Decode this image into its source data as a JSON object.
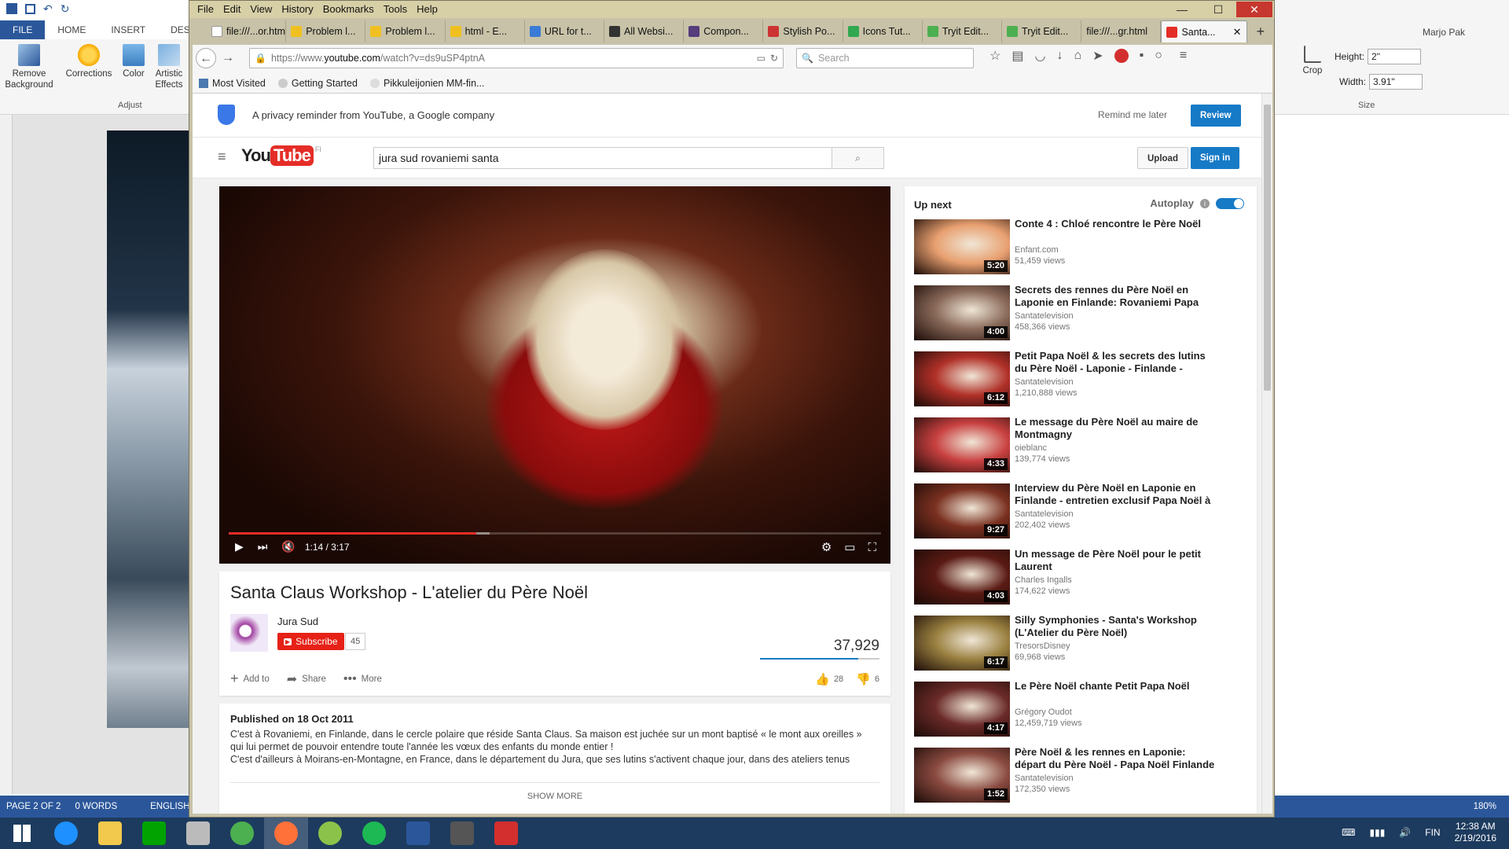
{
  "word": {
    "qat_title": "Marjo Pak",
    "tabs": [
      "FILE",
      "HOME",
      "INSERT",
      "DESIG"
    ],
    "ribbon_buttons": [
      {
        "label": "Remove Background"
      },
      {
        "label": "Corrections"
      },
      {
        "label": "Color"
      },
      {
        "label": "Artistic Effects"
      }
    ],
    "group_label": "Adjust",
    "right_group": {
      "crop_label": "Crop",
      "height_label": "Height:",
      "height_value": "2\"",
      "width_label": "Width:",
      "width_value": "3.91\"",
      "size_label": "Size"
    },
    "status": {
      "page": "PAGE 2 OF 2",
      "words": "0 WORDS",
      "language": "ENGLISH (",
      "zoom": "180%"
    }
  },
  "firefox": {
    "menu": [
      "File",
      "Edit",
      "View",
      "History",
      "Bookmarks",
      "Tools",
      "Help"
    ],
    "tabs": [
      {
        "label": "file:///...or.html",
        "color": "#ffffff"
      },
      {
        "label": "Problem l...",
        "color": "#f0c020"
      },
      {
        "label": "Problem l...",
        "color": "#f0c020"
      },
      {
        "label": "html - E...",
        "color": "#f0c020"
      },
      {
        "label": "URL for t...",
        "color": "#3a7bd5"
      },
      {
        "label": "All Websi...",
        "color": "#333333"
      },
      {
        "label": "Compon...",
        "color": "#563d7c"
      },
      {
        "label": "Stylish Po...",
        "color": "#cc3333"
      },
      {
        "label": "Icons Tut...",
        "color": "#2fa84f"
      },
      {
        "label": "Tryit Edit...",
        "color": "#4caf50"
      },
      {
        "label": "Tryit Edit...",
        "color": "#4caf50"
      },
      {
        "label": "file:///...gr.html",
        "color": "#ffffff"
      },
      {
        "label": "Santa...",
        "color": "#e52d27"
      }
    ],
    "url_prefix": "https://www.",
    "url_domain": "youtube.com",
    "url_path": "/watch?v=ds9uSP4ptnA",
    "search_placeholder": "Search",
    "bookmarks": [
      "Most Visited",
      "Getting Started",
      "Pikkuleijonien MM-fin..."
    ]
  },
  "youtube": {
    "privacy_text": "A privacy reminder from YouTube, a Google company",
    "remind_later": "Remind me later",
    "review": "Review",
    "logo_you": "You",
    "logo_tube": "Tube",
    "logo_region": "FI",
    "search_value": "jura sud rovaniemi santa",
    "upload": "Upload",
    "signin": "Sign in",
    "player": {
      "time": "1:14 / 3:17",
      "progress": 0.38,
      "buffered": 0.4
    },
    "video": {
      "title": "Santa Claus Workshop - L'atelier du Père Noël",
      "channel": "Jura Sud",
      "subscribe": "Subscribe",
      "subscribers": "45",
      "views": "37,929",
      "add_to": "Add to",
      "share": "Share",
      "more": "More",
      "likes": "28",
      "dislikes": "6"
    },
    "description": {
      "published": "Published on 18 Oct 2011",
      "line1": "C'est à Rovaniemi, en Finlande, dans le cercle polaire que réside Santa Claus. Sa maison est juchée sur un mont baptisé « le mont aux oreilles »",
      "line2": "qui lui permet de pouvoir entendre toute l'année les vœux des enfants du monde entier !",
      "line3": "C'est d'ailleurs à Moirans-en-Montagne, en France, dans le département du Jura, que ses lutins s'activent chaque jour, dans des ateliers tenus",
      "show_more": "SHOW MORE"
    },
    "up_next": "Up next",
    "autoplay": "Autoplay",
    "recommendations": [
      {
        "title": "Conte 4 : Chloé rencontre le Père Noël",
        "channel": "Enfant.com",
        "views": "51,459 views",
        "duration": "5:20",
        "color": "#e8a070"
      },
      {
        "title": "Secrets des rennes du Père Noël en Laponie en Finlande: Rovaniemi Papa Noël",
        "channel": "Santatelevision",
        "views": "458,366 views",
        "duration": "4:00",
        "color": "#8a6a5a"
      },
      {
        "title": "Petit Papa Noël & les secrets des lutins du Père Noël - Laponie - Finlande - Rovaniemi -",
        "channel": "Santatelevision",
        "views": "1,210,888 views",
        "duration": "6:12",
        "color": "#b03028"
      },
      {
        "title": "Le message du Père Noël au maire de Montmagny",
        "channel": "oieblanc",
        "views": "139,774 views",
        "duration": "4:33",
        "color": "#c84040"
      },
      {
        "title": "Interview du Père Noël en Laponie en Finlande - entretien exclusif Papa Noël à",
        "channel": "Santatelevision",
        "views": "202,402 views",
        "duration": "9:27",
        "color": "#7a3020"
      },
      {
        "title": "Un message de Père Noël pour le petit Laurent",
        "channel": "Charles Ingalls",
        "views": "174,622 views",
        "duration": "4:03",
        "color": "#5a1a14"
      },
      {
        "title": "Silly Symphonies - Santa's Workshop (L'Atelier du Père Noël)",
        "channel": "TresorsDisney",
        "views": "69,968 views",
        "duration": "6:17",
        "color": "#9a8040"
      },
      {
        "title": "Le Père Noël chante Petit Papa Noël",
        "channel": "Grégory Oudot",
        "views": "12,459,719 views",
        "duration": "4:17",
        "color": "#6a2a28"
      },
      {
        "title": "Père Noël & les rennes en Laponie: départ du Père Noël - Papa Noël Finlande",
        "channel": "Santatelevision",
        "views": "172,350 views",
        "duration": "1:52",
        "color": "#8a4a40"
      }
    ]
  },
  "taskbar": {
    "apps": [
      {
        "name": "start",
        "color": "#ffffff"
      },
      {
        "name": "internet-explorer",
        "color": "#1e90ff"
      },
      {
        "name": "file-explorer",
        "color": "#f2c94c"
      },
      {
        "name": "store",
        "color": "#00a300"
      },
      {
        "name": "paint",
        "color": "#bbbbbb"
      },
      {
        "name": "chrome",
        "color": "#4caf50"
      },
      {
        "name": "firefox",
        "color": "#ff7139"
      },
      {
        "name": "picasa",
        "color": "#8bc34a"
      },
      {
        "name": "spotify",
        "color": "#1db954"
      },
      {
        "name": "word",
        "color": "#2b579a"
      },
      {
        "name": "sublime",
        "color": "#555555"
      },
      {
        "name": "acrobat",
        "color": "#d32f2f"
      }
    ],
    "lang": "FIN",
    "time": "12:38 AM",
    "date": "2/19/2016"
  }
}
